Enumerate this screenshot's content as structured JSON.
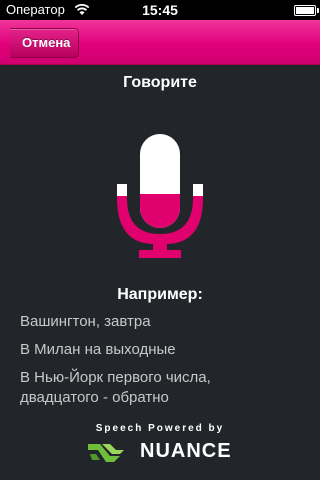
{
  "status_bar": {
    "carrier": "Оператор",
    "time": "15:45"
  },
  "nav": {
    "back_label": "Отмена"
  },
  "prompt": {
    "title": "Говорите"
  },
  "examples": {
    "heading": "Например:",
    "items": [
      "Вашингтон, завтра",
      "В Милан на выходные",
      "В Нью-Йорк первого числа,",
      "двадцатого - обратно"
    ]
  },
  "branding": {
    "powered_by": "Speech Powered by",
    "brand": "NUANCE"
  },
  "colors": {
    "accent": "#e0007b",
    "background": "#22262b",
    "mic_fill": "#e0006e"
  },
  "icons": {
    "wifi": "wifi-icon",
    "battery": "battery-icon",
    "microphone": "microphone-icon",
    "logo": "nuance-logo-icon"
  }
}
